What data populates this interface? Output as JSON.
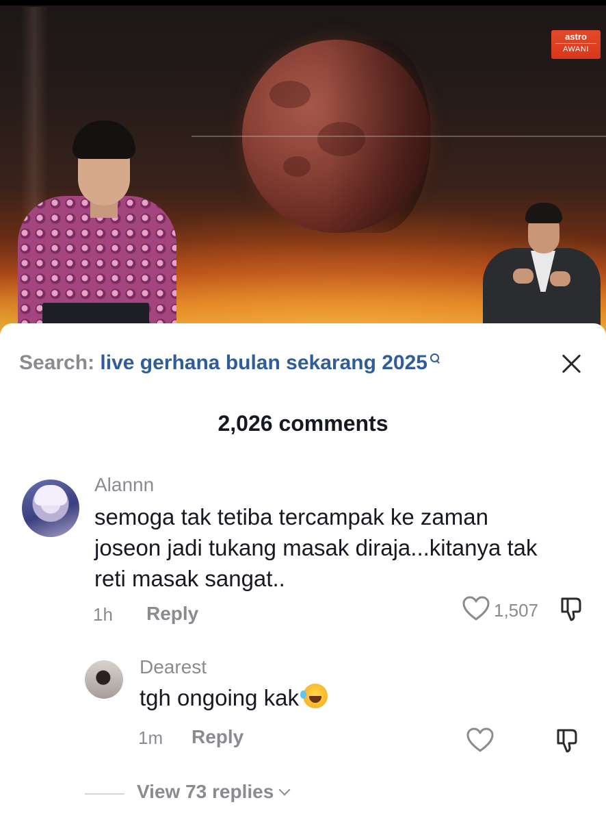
{
  "video": {
    "channel_logo": {
      "line1": "astro",
      "line2": "AWANI"
    },
    "colors": {
      "logo": "#d9361b",
      "moon": "#8a4236"
    }
  },
  "search": {
    "label": "Search:",
    "query": "live gerhana bulan sekarang 2025",
    "icon": "search-icon"
  },
  "close_icon": "close-icon",
  "comments_header": {
    "count_label": "2,026 comments"
  },
  "comments": [
    {
      "username": "Alannn",
      "text_lines": [
        "semoga tak tetiba tercampak ke zaman",
        "joseon jadi tukang masak diraja...kitanya tak",
        "reti masak sangat.."
      ],
      "time": "1h",
      "reply_label": "Reply",
      "likes": "1,507"
    },
    {
      "username": "Dearest",
      "text": "tgh ongoing kak",
      "emoji": "rolling-on-floor-laughing",
      "time": "1m",
      "reply_label": "Reply",
      "likes": ""
    }
  ],
  "view_replies": {
    "label": "View 73 replies"
  },
  "colors": {
    "link_blue": "#2f5d9a",
    "meta_gray": "#8a8b91",
    "text_dark": "#161823"
  }
}
